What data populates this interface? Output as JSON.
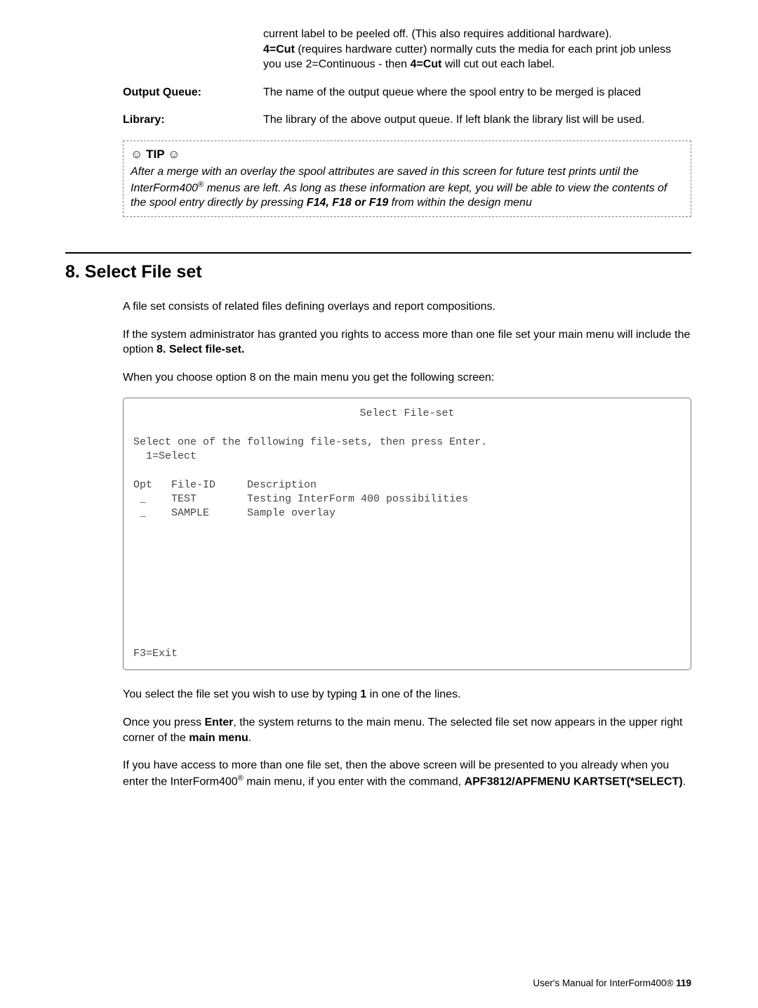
{
  "top_continuation": {
    "line1": "current label to be peeled off. (This also requires additional hardware).",
    "line2_prefix": "4=Cut",
    "line2_rest": " (requires hardware cutter) normally cuts the media for each print job unless you use 2=Continuous - then ",
    "line2_bold2": "4=Cut",
    "line2_tail": " will cut out each label."
  },
  "defs": [
    {
      "label": "Output Queue:",
      "text": "The name of the output queue where the spool entry to be merged is placed"
    },
    {
      "label": "Library:",
      "text": "The library of the above output queue. If left blank the library list will be used."
    }
  ],
  "tip": {
    "title_prefix": "☺ ",
    "title_text": "TIP",
    "title_suffix": " ☺",
    "body_1": " After a merge with an overlay the spool attributes are saved in this screen for future test prints until the InterForm400",
    "body_sup": "®",
    "body_2": " menus are left. As long as these information are kept, you will be able to view the contents of the spool entry directly by pressing ",
    "body_bold": "F14, F18 or F19",
    "body_3": " from within the design menu"
  },
  "section": {
    "title": "8. Select File set",
    "p1": "A file set consists of related files defining overlays and report compositions.",
    "p2_a": "If the system administrator has granted you rights to access more than one file set your main menu will include the option ",
    "p2_b": "8. Select file-set.",
    "p3": "When you choose option 8 on the main menu you get the following screen:"
  },
  "screen": {
    "title": "Select File-set",
    "line_select": "Select one of the following file-sets, then press Enter.",
    "line_opt": "  1=Select",
    "header": "Opt   File-ID     Description",
    "row1": " _    TEST        Testing InterForm 400 possibilities",
    "row2": " _    SAMPLE      Sample overlay",
    "exit": "F3=Exit"
  },
  "after": {
    "p1_a": "You select the file set you wish to use by typing ",
    "p1_b": "1",
    "p1_c": " in one of the lines.",
    "p2_a": "Once you press ",
    "p2_b": "Enter",
    "p2_c": ", the system returns to the main menu. The selected file set now appears in the upper right corner of the ",
    "p2_d": "main menu",
    "p2_e": ".",
    "p3_a": "If you have access to more than one file set, then the above screen will be presented to you already when you enter the InterForm400",
    "p3_sup": "®",
    "p3_b": " main menu, if you enter with the command, ",
    "p3_c": "APF3812/APFMENU KARTSET(*SELECT)",
    "p3_d": "."
  },
  "footer": {
    "text": "User's Manual for InterForm400® ",
    "page": "119"
  }
}
